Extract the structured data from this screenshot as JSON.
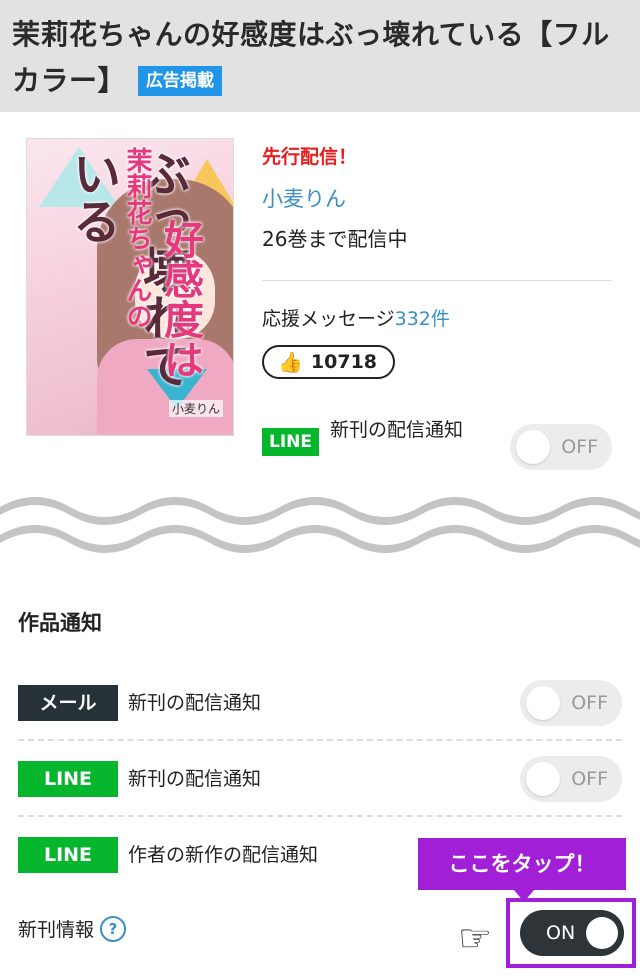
{
  "header": {
    "title": "茉莉花ちゃんの好感度はぶっ壊れている【フルカラー】",
    "ad_badge": "広告掲載"
  },
  "book": {
    "cover": {
      "title_part1": "ぶっ壊れている",
      "title_part2": "茉莉花ちゃんの",
      "title_part3": "好感度は",
      "author": "小麦りん"
    },
    "pre_release": "先行配信！",
    "author": "小麦りん",
    "volumes": "26巻まで配信中",
    "support_label": "応援メッセージ",
    "support_count": "332件",
    "likes": "10718",
    "line_badge": "LINE",
    "line_label": "新刊の配信通知",
    "toggle_off": "OFF"
  },
  "notify": {
    "title": "作品通知",
    "rows": [
      {
        "badge": "メール",
        "label": "新刊の配信通知",
        "toggle": "OFF"
      },
      {
        "badge": "LINE",
        "label": "新刊の配信通知",
        "toggle": "OFF"
      },
      {
        "badge": "LINE",
        "label": "作者の新作の配信通知"
      }
    ],
    "callout": "ここをタップ！",
    "info_label": "新刊情報",
    "help_icon": "?",
    "toggle_on": "ON"
  },
  "colors": {
    "accent_blue": "#3b8fc6",
    "line_green": "#06b72d",
    "callout_purple": "#a11fd7",
    "red": "#e61e1e"
  },
  "icons": {
    "thumb": "thumbs-up-icon",
    "hand": "pointing-hand-icon",
    "help": "help-icon"
  }
}
